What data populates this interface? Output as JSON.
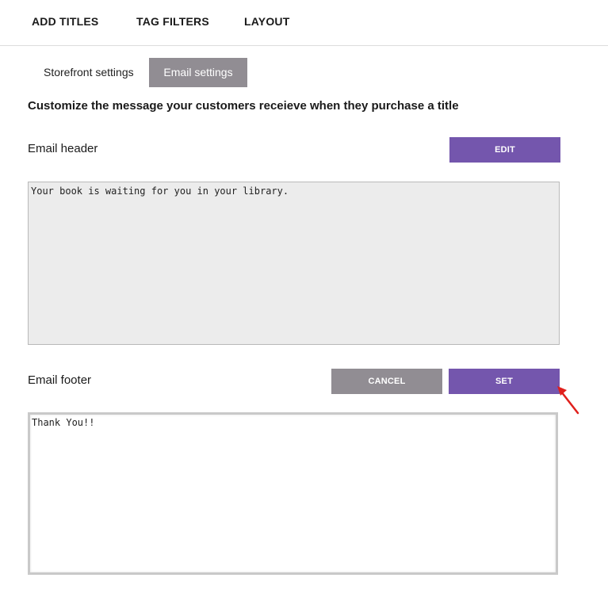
{
  "nav": {
    "items": [
      {
        "label": "ADD TITLES"
      },
      {
        "label": "TAG FILTERS"
      },
      {
        "label": "LAYOUT"
      }
    ]
  },
  "tabs": [
    {
      "label": "Storefront settings",
      "active": false
    },
    {
      "label": "Email settings",
      "active": true
    }
  ],
  "section": {
    "heading": "Customize the message your customers receieve when they purchase a title"
  },
  "email_header": {
    "label": "Email header",
    "edit_label": "EDIT",
    "value": "Your book is waiting for you in your library."
  },
  "email_footer": {
    "label": "Email footer",
    "cancel_label": "CANCEL",
    "set_label": "SET",
    "value": "Thank You!!"
  },
  "colors": {
    "primary": "#7456ad",
    "secondary": "#918d93",
    "annotation_arrow": "#e0201c"
  }
}
